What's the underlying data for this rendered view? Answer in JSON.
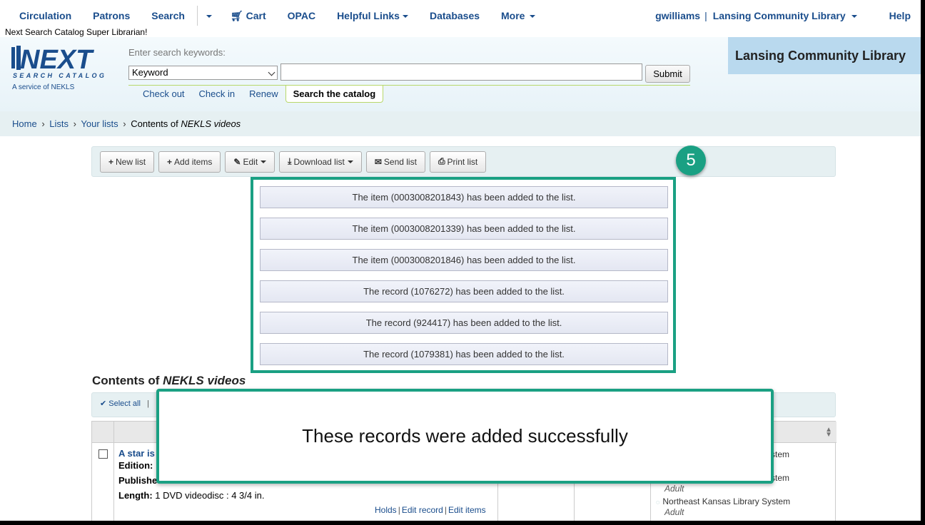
{
  "nav": {
    "items": [
      "Circulation",
      "Patrons",
      "Search"
    ],
    "cart": "Cart",
    "opac": "OPAC",
    "helpful_links": "Helpful Links",
    "databases": "Databases",
    "more": "More",
    "user": "gwilliams",
    "pipe": "|",
    "library": "Lansing Community Library",
    "help": "Help"
  },
  "tagline": "Next Search Catalog Super Librarian!",
  "logo": {
    "text": "NEXT",
    "subtext": "SEARCH CATALOG",
    "service": "A service of NEKLS"
  },
  "search": {
    "hint": "Enter search keywords:",
    "select_value": "Keyword",
    "input_value": "",
    "submit": "Submit",
    "tabs": [
      "Check out",
      "Check in",
      "Renew",
      "Search the catalog"
    ]
  },
  "library_box": "Lansing Community Library",
  "breadcrumb": {
    "items": [
      "Home",
      "Lists",
      "Your lists"
    ],
    "sep": "›",
    "current_prefix": "Contents of ",
    "current_name": "NEKLS videos"
  },
  "toolbar": {
    "new_list": "New list",
    "add_items": "Add items",
    "edit": "Edit",
    "download_list": "Download list",
    "send_list": "Send list",
    "print_list": "Print list"
  },
  "step_number": "5",
  "messages": [
    "The item (0003008201843) has been added to the list.",
    "The item (0003008201339) has been added to the list.",
    "The item (0003008201846) has been added to the list.",
    "The record (1076272) has been added to the list.",
    "The record (924417) has been added to the list.",
    "The record (1079381) has been added to the list."
  ],
  "contents": {
    "prefix": "Contents of ",
    "name": "NEKLS videos"
  },
  "select_all": "Select all",
  "select_sep": "|",
  "item": {
    "title": "A star is",
    "edition_label": "Edition:",
    "publisher_label": "Publishe",
    "length_label": "Length:",
    "length_value": "1 DVD videodisc : 4 3/4 in.",
    "links": [
      "Holds",
      "Edit record",
      "Edit items"
    ],
    "link_sep": "|",
    "locations": [
      {
        "name": "ystem",
        "sub": ""
      },
      {
        "name": "ystem",
        "sub": "Adult"
      },
      {
        "name": "Northeast Kansas Library System",
        "sub": "Adult"
      }
    ]
  },
  "callout": "These records were added successfully",
  "colors": {
    "accent": "#1aa083",
    "link": "#1a4d8c",
    "library_box": "#b9d9ee"
  }
}
